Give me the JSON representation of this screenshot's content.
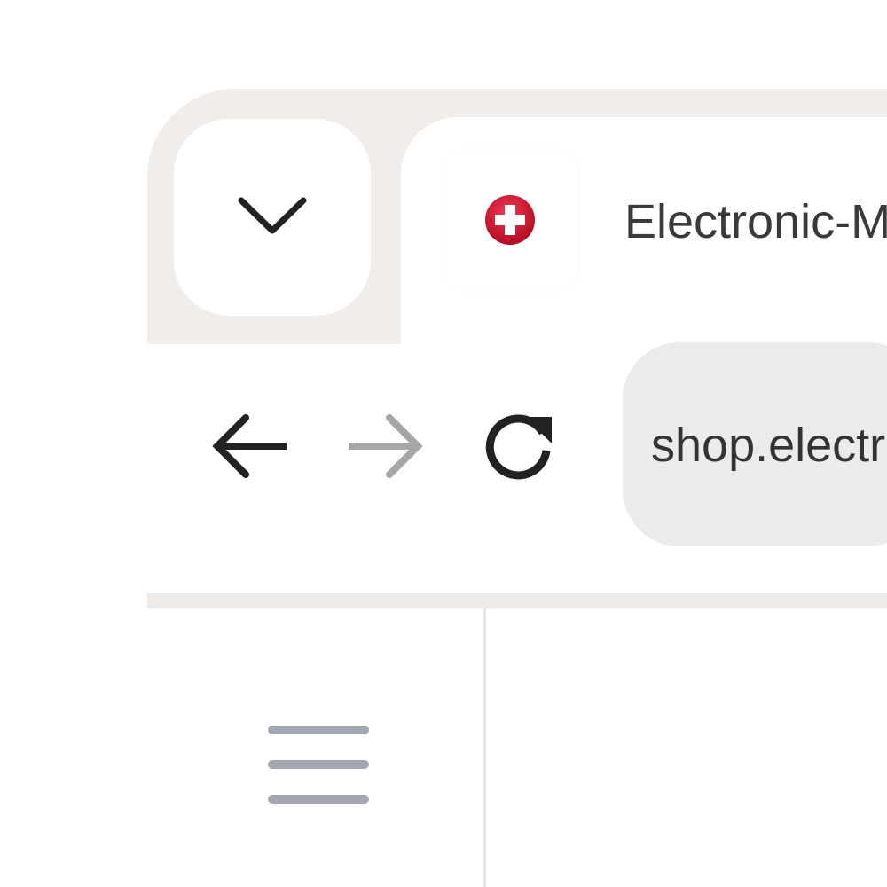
{
  "browser": {
    "tab": {
      "title": "Electronic-M",
      "favicon": "swiss-cross-icon",
      "favicon_color": "#d0112b"
    },
    "tab_list_button": {
      "icon": "chevron-down-icon"
    },
    "navigation": {
      "back": {
        "icon": "arrow-left-icon",
        "enabled": true
      },
      "forward": {
        "icon": "arrow-right-icon",
        "enabled": false
      },
      "reload": {
        "icon": "reload-icon"
      }
    },
    "address_bar": {
      "url": "shop.electr"
    }
  },
  "page": {
    "menu_button": {
      "icon": "hamburger-menu-icon"
    }
  },
  "colors": {
    "tabstrip_bg": "#f1edeb",
    "omnibox_bg": "#ebebeb",
    "icon_dark": "#222222",
    "icon_disabled": "#a6a6a6",
    "menu_icon": "#a3a7b0"
  }
}
